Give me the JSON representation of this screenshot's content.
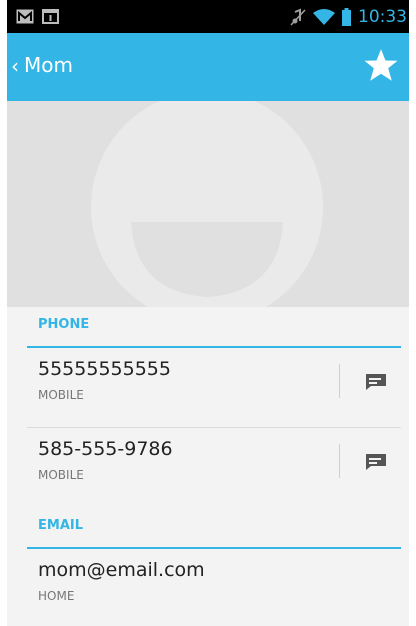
{
  "status_bar": {
    "time": "10:33",
    "left_icons": [
      "gmail-icon",
      "calendar-icon"
    ],
    "right_icons": [
      "muted-icon",
      "wifi-icon",
      "battery-icon"
    ]
  },
  "action_bar": {
    "title": "Mom",
    "back_icon": "chevron-left-icon",
    "favorite_icon": "star-icon"
  },
  "sections": {
    "phone": {
      "header": "PHONE",
      "items": [
        {
          "number": "55555555555",
          "type": "MOBILE"
        },
        {
          "number": "585-555-9786",
          "type": "MOBILE"
        }
      ]
    },
    "email": {
      "header": "EMAIL",
      "items": [
        {
          "address": "mom@email.com",
          "type": "HOME"
        }
      ]
    }
  },
  "colors": {
    "accent": "#33b5e5",
    "status_bar": "#000000",
    "photo_bg": "#e0e0e0"
  }
}
